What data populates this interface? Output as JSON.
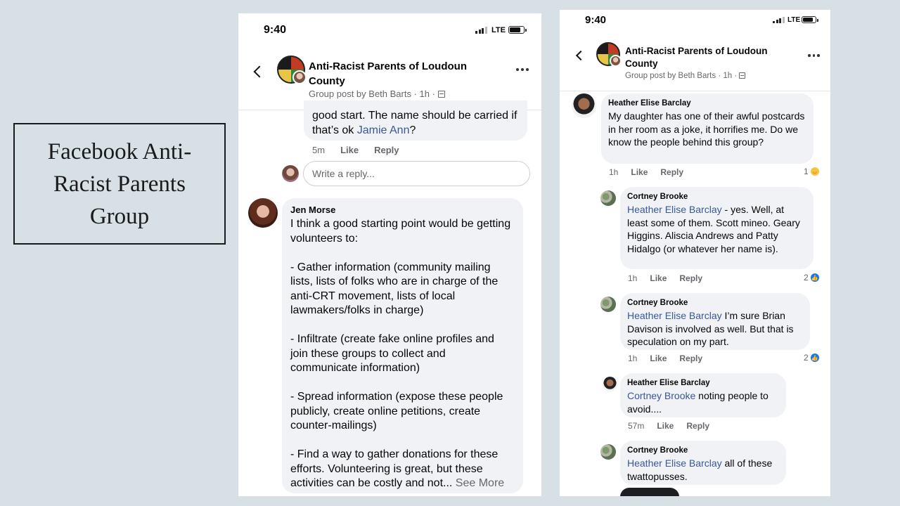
{
  "slide_title": "Facebook Anti-Racist Parents Group",
  "phone_left": {
    "time": "9:40",
    "network": "LTE",
    "group_name": "Anti-Racist Parents of Loudoun County",
    "group_sub": "Group post by Beth Barts · 1h ·",
    "prev_comment": {
      "text_before": "good start. The name should be carried if that’s ok ",
      "mention": "Jamie Ann",
      "text_after": "?",
      "time": "5m",
      "like": "Like",
      "reply": "Reply"
    },
    "reply_placeholder": "Write a reply...",
    "jen": {
      "name": "Jen Morse",
      "text": "I think a good starting point would be getting volunteers to:\n\n- Gather information (community mailing lists, lists of folks who are in charge of the anti-CRT movement, lists of local lawmakers/folks in charge)\n\n- Infiltrate (create fake online profiles and join these groups to collect and communicate information)\n\n- Spread information (expose these people publicly, create online petitions, create counter-mailings)\n\n- Find a way to gather donations for these efforts.  Volunteering is great, but these activities can be costly and not...",
      "see_more": "See More"
    }
  },
  "phone_right": {
    "time": "9:40",
    "network": "LTE",
    "group_name": "Anti-Racist Parents of Loudoun County",
    "group_sub": "Group post by Beth Barts · 1h ·",
    "comments": [
      {
        "name": "Heather Elise Barclay",
        "mention": "",
        "text": "My daughter has one of their awful postcards in her room as a joke, it horrifies me. Do we know the people behind this group?",
        "time": "1h",
        "like": "Like",
        "reply": "Reply",
        "reactions": "1",
        "reaction_icon": "haha-icon"
      },
      {
        "name": "Cortney Brooke",
        "mention": "Heather Elise Barclay",
        "text": " - yes. Well, at least some of them. Scott mineo. Geary Higgins. Aliscia Andrews and Patty Hidalgo (or whatever her name is).",
        "time": "1h",
        "like": "Like",
        "reply": "Reply",
        "reactions": "2",
        "reaction_icon": "like-icon"
      },
      {
        "name": "Cortney Brooke",
        "mention": "Heather Elise Barclay",
        "text": " I’m sure Brian Davison is involved as well. But that is speculation on my part.",
        "time": "1h",
        "like": "Like",
        "reply": "Reply",
        "reactions": "2",
        "reaction_icon": "like-icon"
      },
      {
        "name": "Heather Elise Barclay",
        "mention": "Cortney Brooke",
        "text": " noting people to avoid....",
        "time": "57m",
        "like": "Like",
        "reply": "Reply",
        "reactions": "",
        "reaction_icon": ""
      },
      {
        "name": "Cortney Brooke",
        "mention": "Heather Elise Barclay",
        "text": " all of these twattopusses.",
        "time": "",
        "like": "",
        "reply": "",
        "reactions": "",
        "reaction_icon": ""
      }
    ]
  }
}
